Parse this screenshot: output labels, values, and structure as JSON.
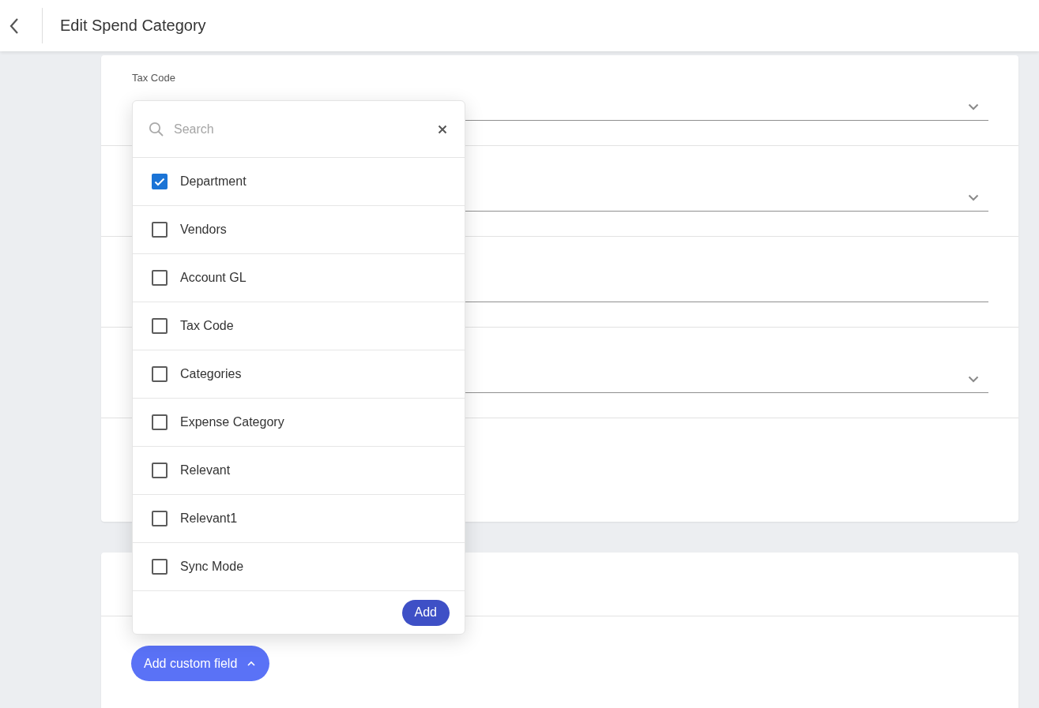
{
  "header": {
    "title": "Edit Spend Category"
  },
  "fields": [
    {
      "label": "Tax Code",
      "kind": "select"
    },
    {
      "kind": "select"
    },
    {
      "kind": "text"
    },
    {
      "kind": "select"
    }
  ],
  "dropdown": {
    "search": {
      "placeholder": "Search"
    },
    "options": [
      {
        "label": "Department",
        "checked": true
      },
      {
        "label": "Vendors",
        "checked": false
      },
      {
        "label": "Account GL",
        "checked": false
      },
      {
        "label": "Tax Code",
        "checked": false
      },
      {
        "label": "Categories",
        "checked": false
      },
      {
        "label": "Expense Category",
        "checked": false
      },
      {
        "label": "Relevant",
        "checked": false
      },
      {
        "label": "Relevant1",
        "checked": false
      },
      {
        "label": "Sync Mode",
        "checked": false
      }
    ],
    "add_button": "Add"
  },
  "add_custom_field_button": {
    "label": "Add custom field",
    "expanded": true
  }
}
